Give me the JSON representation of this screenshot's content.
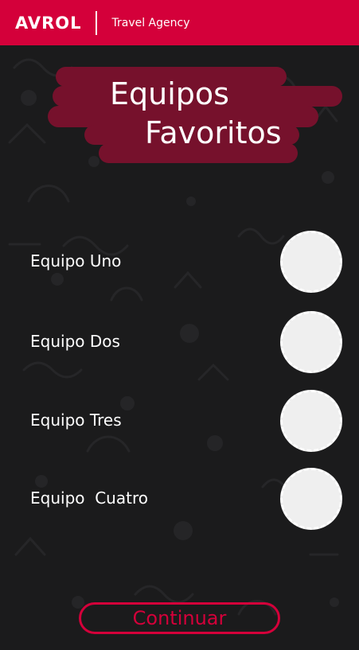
{
  "header": {
    "brand": "AVROL",
    "tagline": "Travel Agency",
    "background_color": "#d4003a"
  },
  "title": {
    "line1": "Equipos",
    "line2": "Favoritos",
    "brush_color": "#76112c"
  },
  "teams": [
    {
      "label": "Equipo Uno",
      "slot_icon": "empty-dashed-circle"
    },
    {
      "label": "Equipo Dos",
      "slot_icon": "empty-dashed-circle"
    },
    {
      "label": "Equipo Tres",
      "slot_icon": "empty-dashed-circle"
    },
    {
      "label": "Equipo  Cuatro",
      "slot_icon": "empty-dashed-circle"
    }
  ],
  "actions": {
    "continue_label": "Continuar",
    "accent_color": "#d4003a"
  },
  "theme": {
    "background": "#1b1b1c",
    "pattern": "subtle-doodle-icons"
  }
}
